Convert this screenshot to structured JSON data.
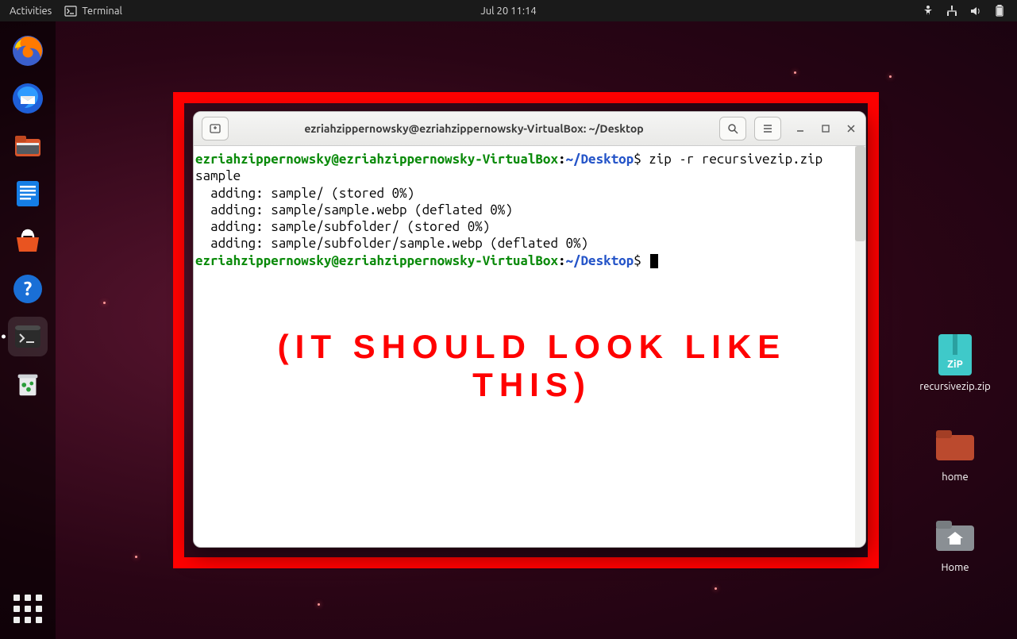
{
  "topbar": {
    "activities": "Activities",
    "app_name": "Terminal",
    "clock": "Jul 20  11:14"
  },
  "dock": {
    "items": [
      {
        "name": "firefox"
      },
      {
        "name": "thunderbird"
      },
      {
        "name": "files"
      },
      {
        "name": "writer"
      },
      {
        "name": "software"
      },
      {
        "name": "help"
      },
      {
        "name": "terminal",
        "active": true
      },
      {
        "name": "trash"
      }
    ]
  },
  "desktop_icons": {
    "zip_label": "recursivezip.zip",
    "home_folder_label": "home",
    "user_home_label": "Home"
  },
  "terminal": {
    "title": "ezriahzippernowsky@ezriahzippernowsky-VirtualBox: ~/Desktop",
    "prompt_user": "ezriahzippernowsky@ezriahzippernowsky-VirtualBox",
    "prompt_sep": ":",
    "prompt_path": "~/Desktop",
    "prompt_sigil": "$",
    "command": " zip -r recursivezip.zip sample",
    "output": [
      "  adding: sample/ (stored 0%)",
      "  adding: sample/sample.webp (deflated 0%)",
      "  adding: sample/subfolder/ (stored 0%)",
      "  adding: sample/subfolder/sample.webp (deflated 0%)"
    ]
  },
  "annotation": "(IT SHOULD LOOK LIKE THIS)"
}
